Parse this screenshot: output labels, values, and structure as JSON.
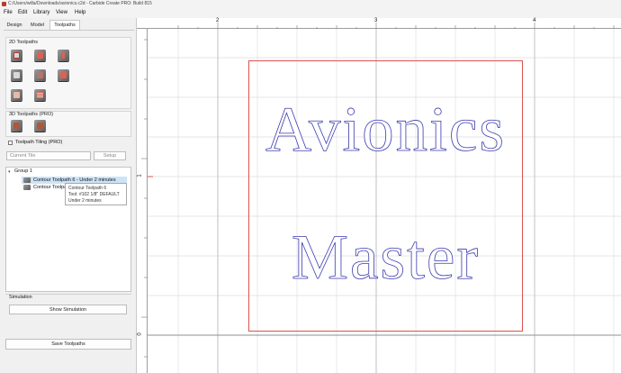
{
  "window": {
    "title": "C:/Users/willa/Downloads/avionics.c2d - Carbide Create PRO: Build 815"
  },
  "menu": [
    {
      "label": "File"
    },
    {
      "label": "Edit"
    },
    {
      "label": "Library"
    },
    {
      "label": "View"
    },
    {
      "label": "Help"
    }
  ],
  "tabs": [
    {
      "label": "Design",
      "active": false
    },
    {
      "label": "Model",
      "active": false
    },
    {
      "label": "Toolpaths",
      "active": true
    }
  ],
  "toolpaths_2d": {
    "heading": "2D Toolpaths",
    "tools": [
      "contour-toolpath",
      "pocket-toolpath",
      "drill-toolpath",
      "v-carve-toolpath",
      "texture-toolpath",
      "advanced-v-carve-toolpath",
      "rough-toolpath",
      "finish-toolpath"
    ]
  },
  "toolpaths_3d": {
    "heading": "3D Toolpaths (PRO)",
    "tools": [
      "3d-rough-toolpath",
      "3d-finish-toolpath"
    ]
  },
  "tiling": {
    "checkbox_label": "Toolpath Tiling (PRO)",
    "checked": false,
    "select_value": "Current Tile",
    "setup_label": "Setup"
  },
  "tree": {
    "group_label": "Group 1",
    "items": [
      {
        "label": "Contour Toolpath 6 - Under 2 minutes",
        "selected": true
      },
      {
        "label": "Contour Toolpa",
        "selected": false
      }
    ],
    "tooltip": {
      "line1": "Contour Toolpath 6",
      "line2": "Tool: #102 1/8\" DEFAULT",
      "line3": "Under 2 minutes"
    }
  },
  "simulation": {
    "heading": "Simulation",
    "show_label": "Show Simulation",
    "save_label": "Save Toolpaths"
  },
  "rulers": {
    "top": [
      "2",
      "3",
      "4"
    ],
    "left": [
      "1",
      "0"
    ]
  },
  "design": {
    "line1": "Avionics",
    "line2": "Master",
    "stock_color": "#d9534f",
    "text_color": "#3a3ab0"
  },
  "colors": {
    "accent": "#cce4f7",
    "panel_bg": "#f0f0f0",
    "grid": "#dcdcdc"
  }
}
